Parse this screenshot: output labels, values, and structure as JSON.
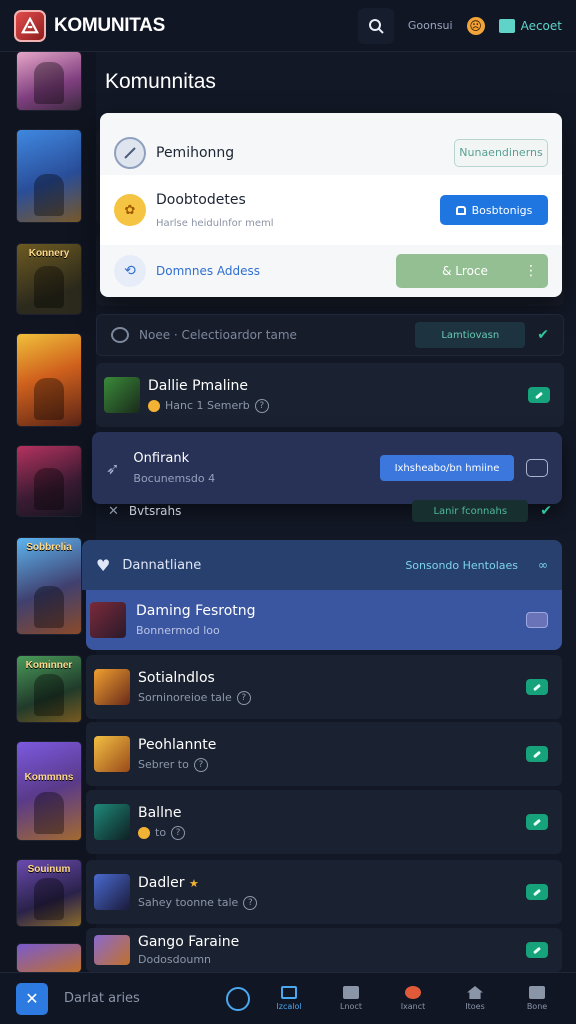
{
  "app": {
    "title": "KOMUNITAS",
    "account_label": "Aecoet",
    "topbar_status": "Goonsui"
  },
  "page": {
    "title": "Komunnitas"
  },
  "panel": {
    "items": [
      {
        "title": "Pemihonng",
        "action": "Nunaendinerns"
      },
      {
        "title": "Doobtodetes",
        "subtitle": "Harlse heidulnfor meml",
        "action": "Bosbtonigs"
      },
      {
        "title": "Domnnes Addess",
        "action": "& Lroce"
      }
    ]
  },
  "filter": {
    "text": "Noee · Celectioardor tame",
    "button": "Lamtiovasn"
  },
  "list_top": [
    {
      "title": "Dallie Pmaline",
      "subtitle": "Hanc 1 Semerb"
    }
  ],
  "popup": {
    "title": "Onfirank",
    "subtitle": "Bocunemsdo 4",
    "button": "Ixhsheabo/bn hmiine"
  },
  "extra_row": {
    "label": "Bvtsrahs",
    "button": "Lanir fconnahs"
  },
  "highlight": {
    "header": "Dannatliane",
    "link": "Sonsondo Hentolaes",
    "row_title": "Daming Fesrotng",
    "row_subtitle": "Bonnermod loo"
  },
  "list_bottom": [
    {
      "title": "Sotialndlos",
      "subtitle": "Sorninoreioe tale"
    },
    {
      "title": "Peohlannte",
      "subtitle": "Sebrer to"
    },
    {
      "title": "Ballne",
      "subtitle": "to"
    },
    {
      "title": "Dadler",
      "subtitle": "Sahey toonne tale"
    },
    {
      "title": "Gango Faraine",
      "subtitle": "Dodosdoumn"
    }
  ],
  "thumbs": [
    "",
    "",
    "Konnery",
    "",
    "",
    "Sobbrelia",
    "Kominner",
    "Kommnns",
    "Souinum",
    ""
  ],
  "bottom_nav": {
    "search_placeholder": "Darlat aries",
    "items": [
      "Izcalol",
      "Lnoct",
      "Ixanct",
      "Itoes",
      "Bone"
    ]
  },
  "colors": {
    "accent": "#1f76e0",
    "success": "#16a27a",
    "background": "#121826",
    "panel": "#f6f7f9"
  }
}
